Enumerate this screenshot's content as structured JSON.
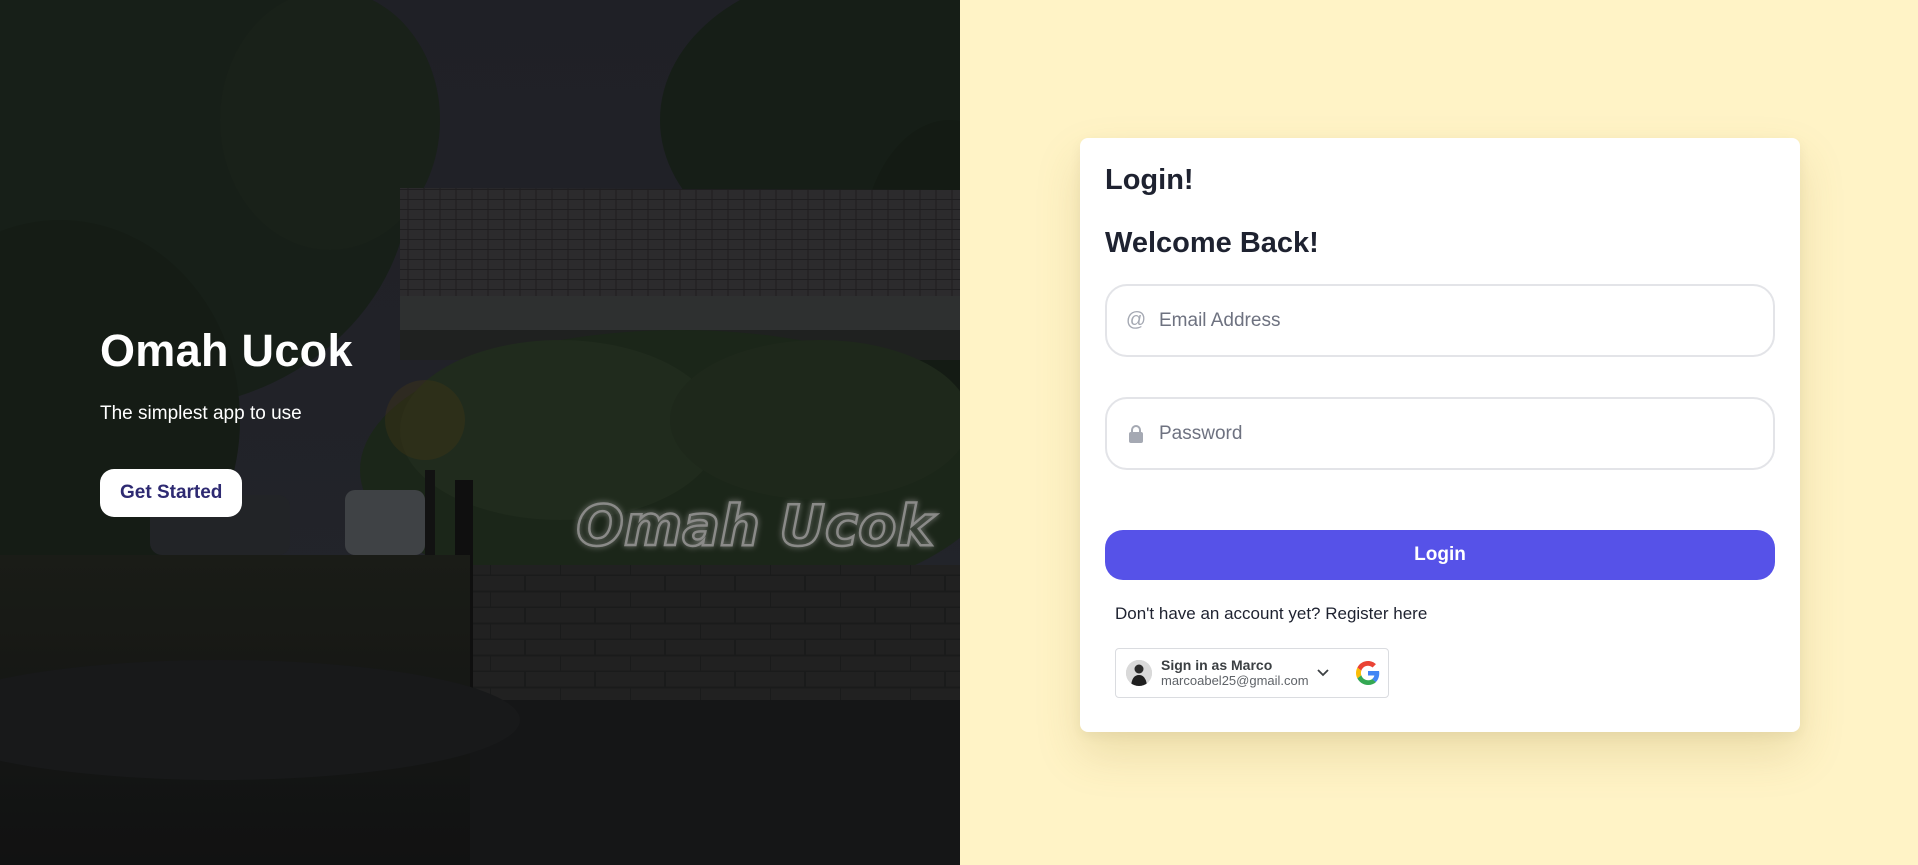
{
  "hero": {
    "title": "Omah Ucok",
    "subtitle": "The simplest app to use",
    "cta_label": "Get Started",
    "sign_text": "Omah Ucok"
  },
  "login": {
    "heading": "Login!",
    "subheading": "Welcome Back!",
    "email_placeholder": "Email Address",
    "email_value": "",
    "password_placeholder": "Password",
    "password_value": "",
    "submit_label": "Login",
    "register_text": "Don't have an account yet? Register here"
  },
  "google_signin": {
    "title": "Sign in as Marco",
    "email": "marcoabel25@gmail.com"
  },
  "colors": {
    "panel_bg": "#fff3c6",
    "primary": "#5652e8",
    "cta_text": "#2e2a72"
  },
  "icons": {
    "email": "at-icon",
    "password": "lock-icon",
    "google": "google-logo-icon",
    "chevron": "chevron-down-icon"
  }
}
